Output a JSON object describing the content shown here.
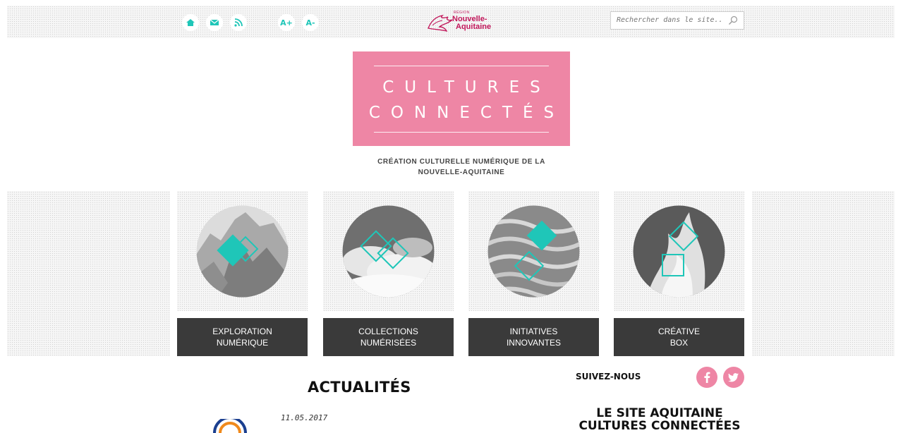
{
  "toolbar": {
    "home_icon": "home-icon",
    "mail_icon": "mail-icon",
    "rss_icon": "rss-icon",
    "font_increase": "A+",
    "font_decrease": "A-"
  },
  "region_logo": {
    "small": "RÉGION",
    "line1": "Nouvelle-",
    "line2": "Aquitaine"
  },
  "search": {
    "placeholder": "Rechercher dans le site..."
  },
  "hero": {
    "line1": "CULTURES",
    "line2": "CONNECTÉS"
  },
  "subtitle": {
    "line1": "CRÉATION CULTURELLE NUMÉRIQUE DE LA",
    "line2": "NOUVELLE-AQUITAINE"
  },
  "tiles": [
    {
      "line1": "EXPLORATION",
      "line2": "NUMÉRIQUE"
    },
    {
      "line1": "COLLECTIONS",
      "line2": "NUMÉRISÉES"
    },
    {
      "line1": "INITIATIVES",
      "line2": "INNOVANTES"
    },
    {
      "line1": "CRÉATIVE",
      "line2": "BOX"
    }
  ],
  "news": {
    "title": "ACTUALITÉS",
    "date": "11.05.2017"
  },
  "social": {
    "label": "SUIVEZ-NOUS"
  },
  "site": {
    "line1": "LE SITE AQUITAINE",
    "line2": "CULTURES CONNECTÉES"
  },
  "colors": {
    "accent": "#1fc6b8",
    "pink": "#ee86a5",
    "dark_label": "#3a3a3a"
  }
}
